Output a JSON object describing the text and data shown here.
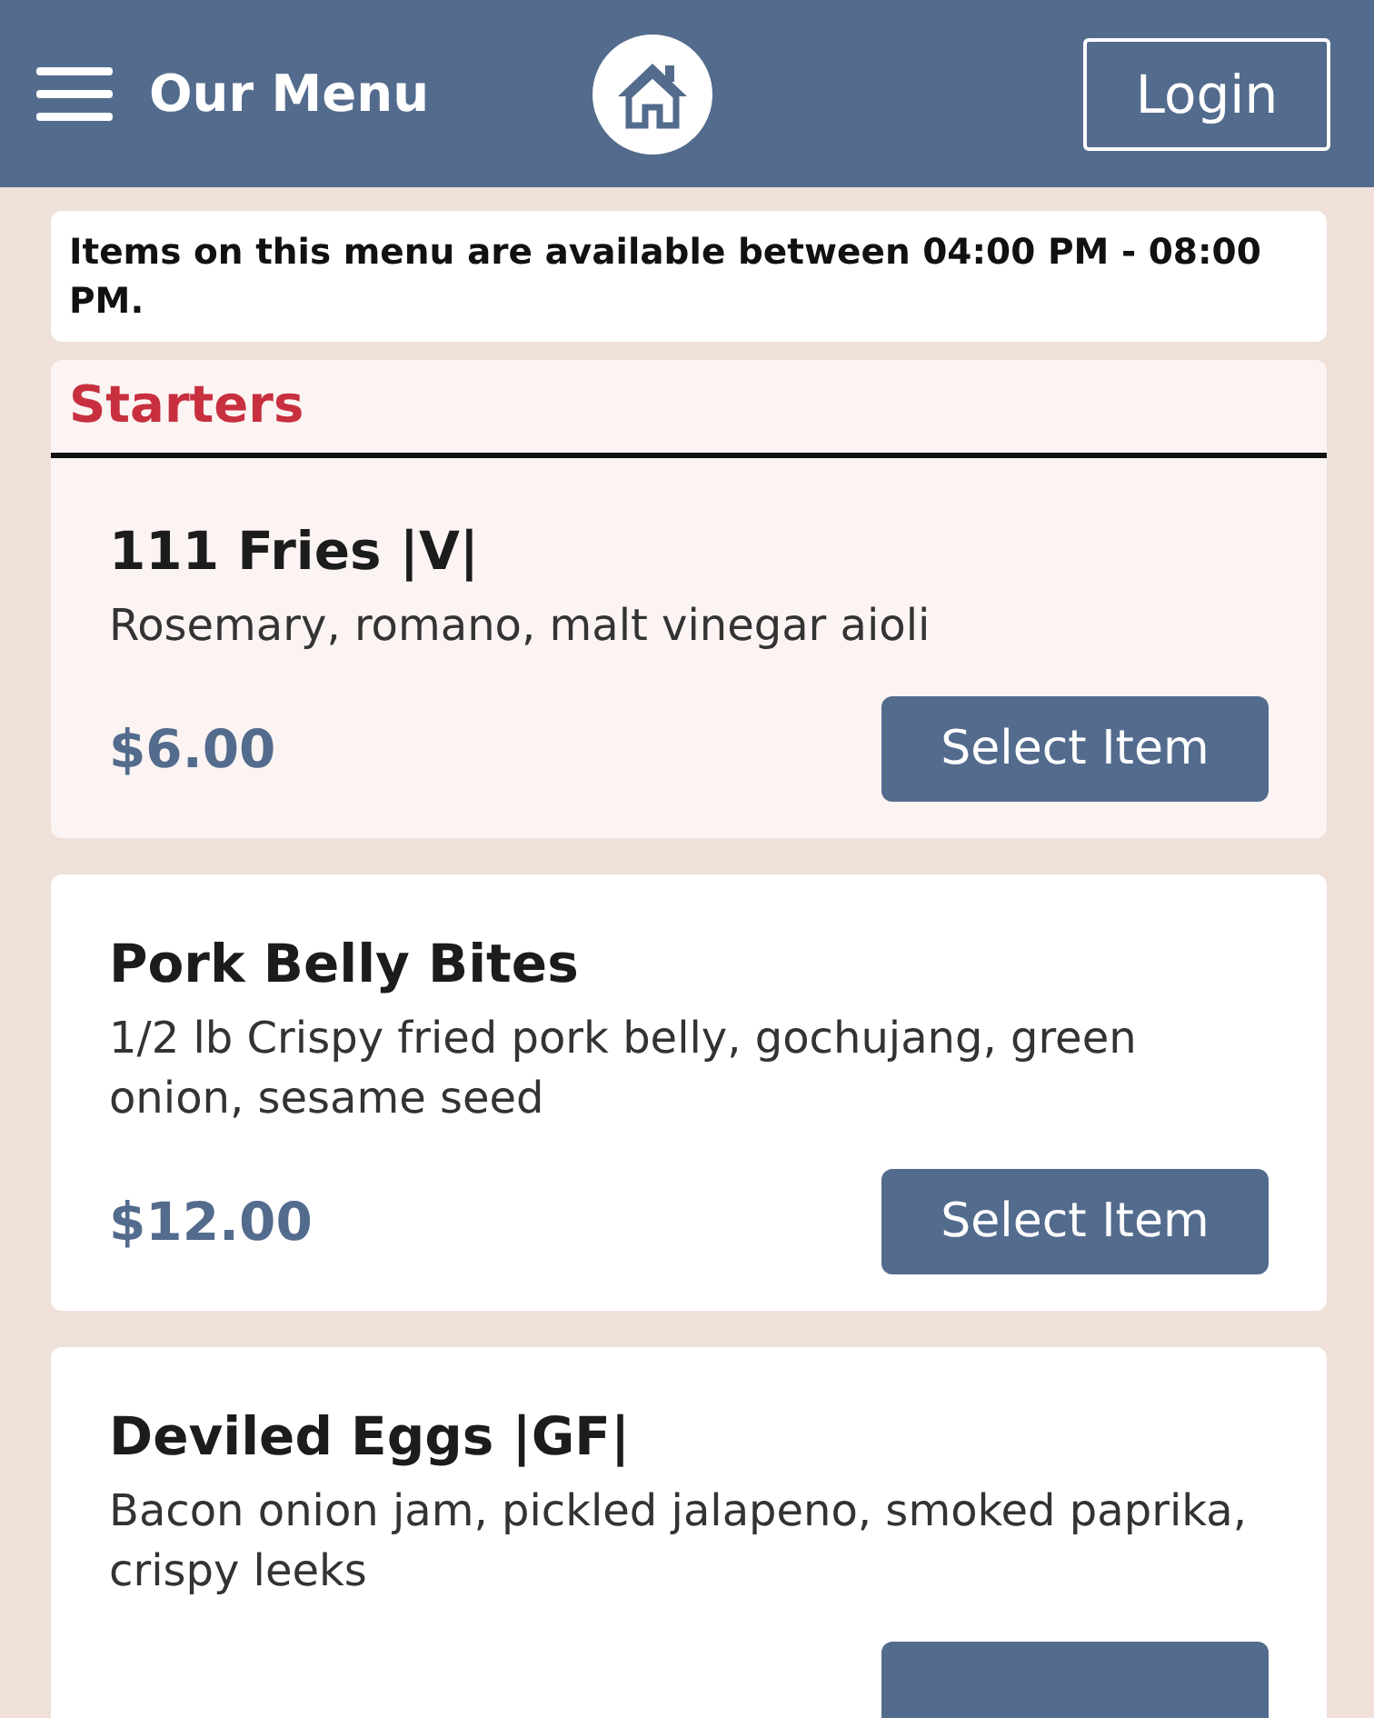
{
  "header": {
    "title": "Our Menu",
    "login": "Login"
  },
  "notice": "Items on this menu are available between 04:00 PM - 08:00 PM.",
  "section": {
    "title": "Starters"
  },
  "items": [
    {
      "name": "111 Fries |V|",
      "description": "Rosemary, romano, malt vinegar aioli",
      "price": "$6.00",
      "button": "Select Item",
      "tinted": true
    },
    {
      "name": "Pork Belly Bites",
      "description": "1/2 lb Crispy fried pork belly, gochujang, green onion, sesame seed",
      "price": "$12.00",
      "button": "Select Item",
      "tinted": false
    },
    {
      "name": "Deviled Eggs |GF|",
      "description": "Bacon onion jam, pickled jalapeno, smoked paprika, crispy leeks",
      "tinted": false
    }
  ]
}
